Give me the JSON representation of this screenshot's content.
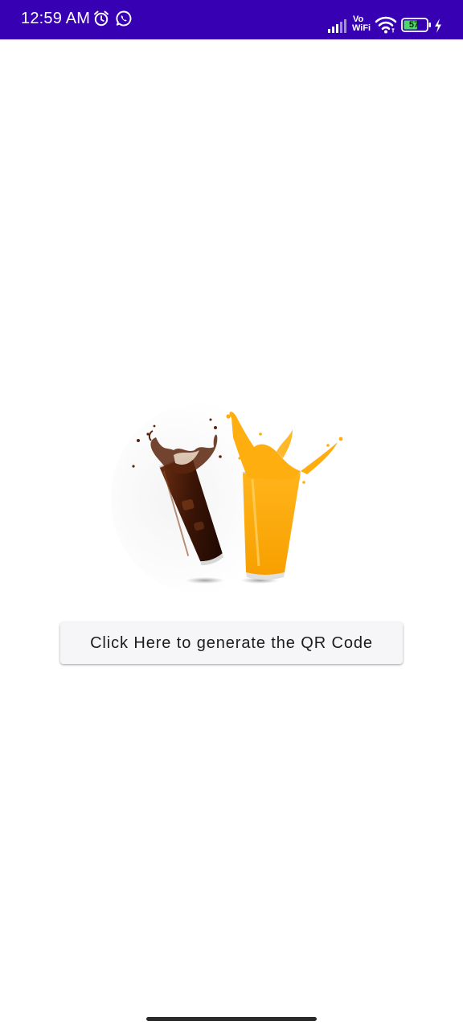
{
  "status_bar": {
    "time": "12:59 AM",
    "battery_level": "57",
    "network_label_top": "Vo",
    "network_label_bottom": "WiFi",
    "background_color": "#3700b3",
    "icons": [
      "alarm-icon",
      "whatsapp-icon",
      "signal-icon",
      "vowifi-icon",
      "wifi-icon",
      "battery-icon",
      "charging-icon"
    ]
  },
  "main": {
    "image_icon": "drinks-illustration",
    "button_label": "Click Here to generate the QR Code"
  },
  "navigation": {
    "gesture_handle": "home-indicator"
  }
}
